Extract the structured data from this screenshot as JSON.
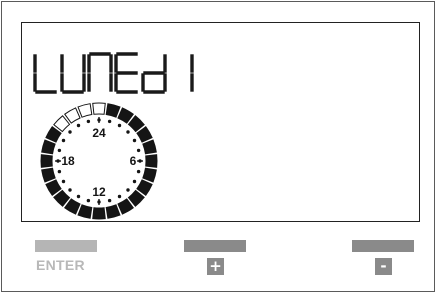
{
  "display": {
    "day": "LUNEDI",
    "clock": {
      "labels": [
        "24",
        "6",
        "12",
        "18"
      ],
      "segments_total": 24,
      "segments_active_hours": [
        1,
        2,
        3,
        4,
        5,
        6,
        7,
        8,
        9,
        10,
        11,
        12,
        13,
        14,
        15,
        16,
        17,
        18,
        19,
        20
      ]
    }
  },
  "controls": {
    "enter_label": "ENTER",
    "plus_symbol": "+",
    "minus_symbol": "-",
    "colors": {
      "enter": "#b5b5b5",
      "plus_minus": "#8a8a8a"
    }
  }
}
